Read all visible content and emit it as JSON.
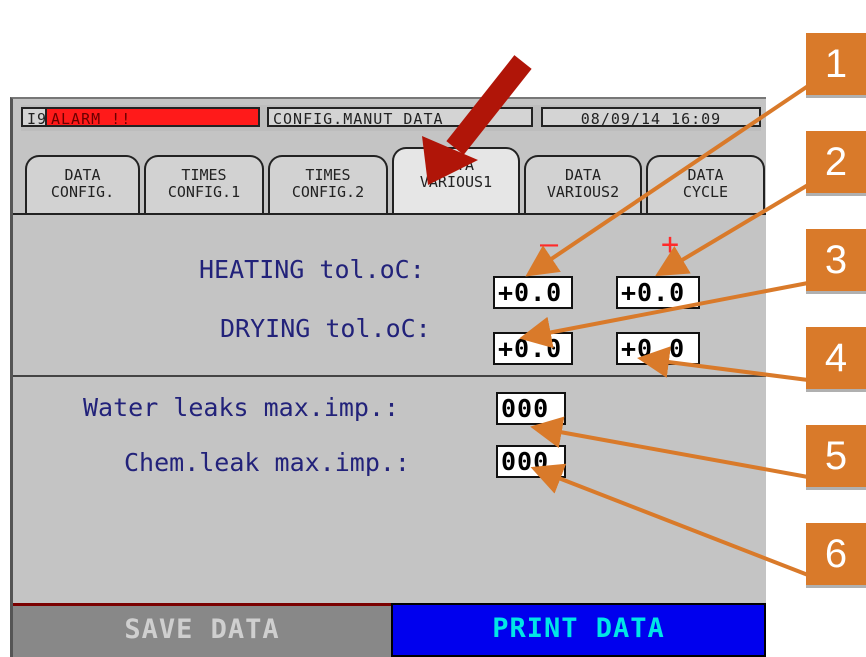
{
  "status_bar": {
    "code": "I9",
    "alarm": "ALARM !!",
    "mode": "CONFIG.MANUT   DATA",
    "datetime": "08/09/14  16:09"
  },
  "tabs": [
    {
      "label": "DATA\nCONFIG."
    },
    {
      "label": "TIMES\nCONFIG.1"
    },
    {
      "label": "TIMES\nCONFIG.2"
    },
    {
      "label": "DATA\nVARIOUS1"
    },
    {
      "label": "DATA\nVARIOUS2"
    },
    {
      "label": "DATA\nCYCLE"
    }
  ],
  "active_tab": "DATA VARIOUS1",
  "columns": {
    "minus": "—",
    "plus": "+"
  },
  "fields": {
    "heating_label": "HEATING tol.oC:",
    "heating_minus": "+0.0",
    "heating_plus": "+0.0",
    "drying_label": "DRYING tol.oC:",
    "drying_minus": "+0.0",
    "drying_plus": "+0.0",
    "water_label": "Water leaks max.imp.:",
    "water_value": "000",
    "chem_label": "Chem.leak max.imp.:",
    "chem_value": "000"
  },
  "buttons": {
    "save": "SAVE DATA",
    "print": "PRINT DATA"
  },
  "callouts": [
    "1",
    "2",
    "3",
    "4",
    "5",
    "6"
  ],
  "colors": {
    "callout": "#d97a2a",
    "arrow": "#c0180a",
    "alarm": "#ff1a1a",
    "print_button": "#0000ee",
    "field_label": "#22227a"
  },
  "icons": {
    "pointer": "red-arrow-icon"
  }
}
